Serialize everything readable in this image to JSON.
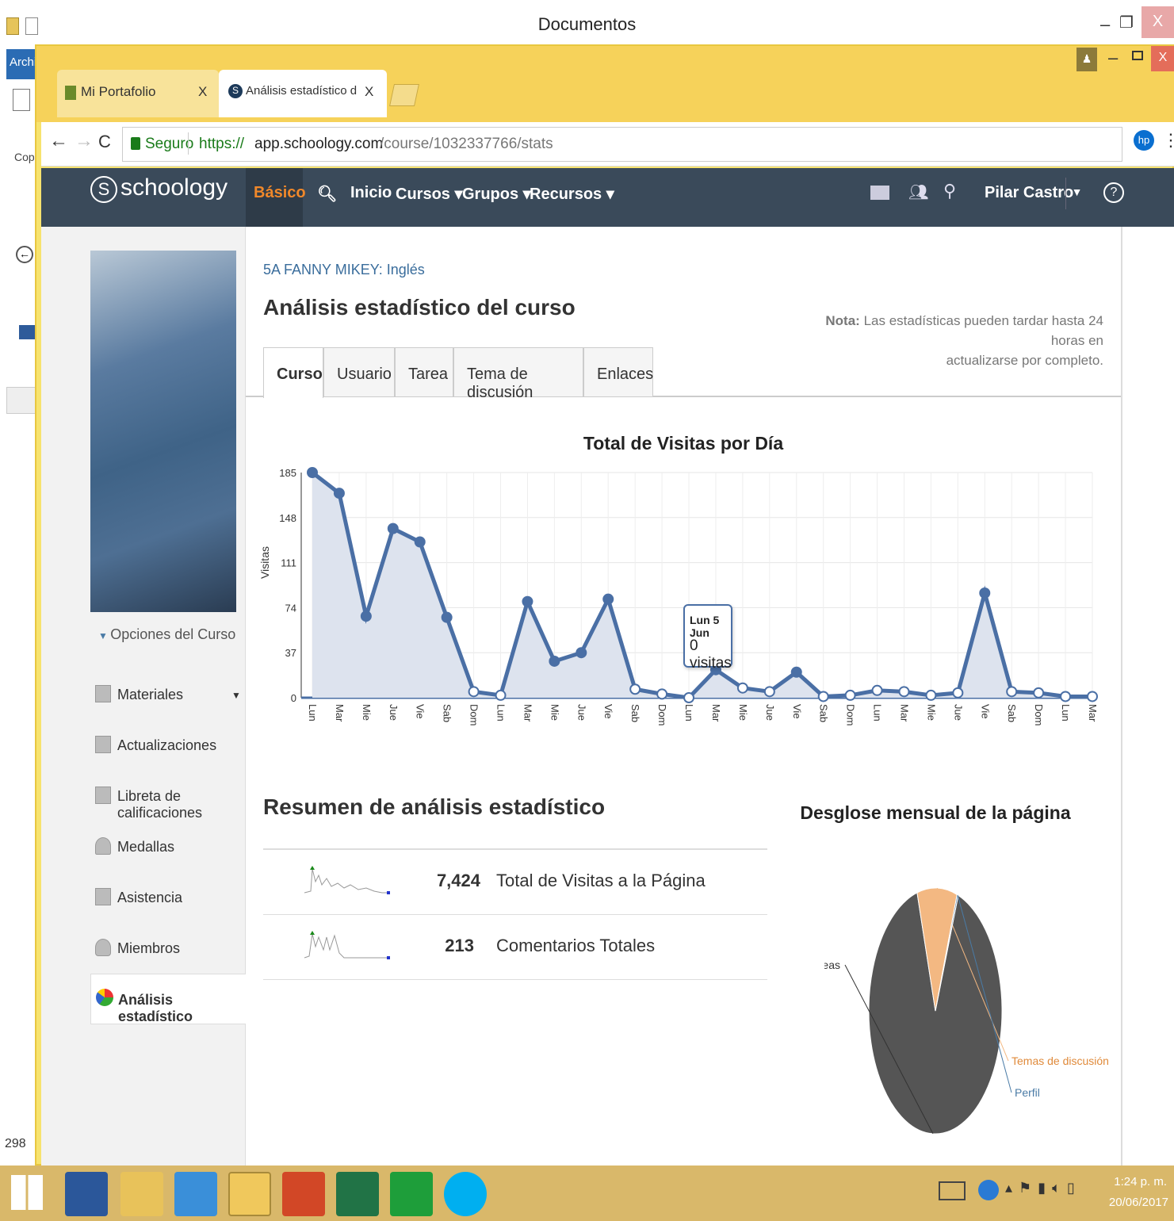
{
  "explorer": {
    "title": "Documentos",
    "tab": "Archi",
    "copy_label": "Copi",
    "count": "298"
  },
  "browser": {
    "tabs": [
      {
        "label": "Mi Portafolio",
        "close": "X"
      },
      {
        "label": "Análisis estadístico del cu",
        "close": "X"
      }
    ],
    "secure": "Seguro",
    "url_scheme": "https://",
    "url_host": "app.schoology.com",
    "url_path": "/course/1032337766/stats"
  },
  "nav": {
    "logo": "schoology",
    "basico": "Básico",
    "inicio": "Inicio",
    "cursos": "Cursos ▾",
    "grupos": "Grupos ▾",
    "recursos": "Recursos ▾",
    "user": "Pilar Castro",
    "help": "?"
  },
  "sidebar": {
    "options": "Opciones del Curso",
    "items": [
      "Materiales",
      "Actualizaciones",
      "Libreta de calificaciones",
      "Medallas",
      "Asistencia",
      "Miembros",
      "Análisis estadístico"
    ]
  },
  "page": {
    "breadcrumb": "5A FANNY MIKEY: Inglés",
    "title": "Análisis estadístico del curso",
    "note_bold": "Nota:",
    "note_line1": "Las estadísticas pueden tardar hasta 24 horas en",
    "note_line2": "actualizarse por completo.",
    "tabs": [
      "Curso",
      "Usuario",
      "Tarea",
      "Tema de discusión",
      "Enlaces"
    ]
  },
  "chart_data": [
    {
      "type": "line",
      "title": "Total de Visitas por Día",
      "ylabel": "Visitas",
      "ylim": [
        0,
        185
      ],
      "yticks": [
        0,
        37,
        74,
        111,
        148,
        185
      ],
      "categories": [
        "Lun",
        "Mar",
        "Mie",
        "Jue",
        "Vie",
        "Sab",
        "Dom",
        "Lun",
        "Mar",
        "Mie",
        "Jue",
        "Vie",
        "Sab",
        "Dom",
        "Lun",
        "Mar",
        "Mie",
        "Jue",
        "Vie",
        "Sab",
        "Dom",
        "Lun",
        "Mar",
        "Mie",
        "Jue",
        "Vie",
        "Sab",
        "Dom",
        "Lun",
        "Mar"
      ],
      "values": [
        185,
        168,
        67,
        139,
        128,
        66,
        5,
        2,
        79,
        30,
        37,
        81,
        7,
        3,
        0,
        23,
        8,
        5,
        21,
        1,
        2,
        6,
        5,
        2,
        4,
        86,
        5,
        4,
        1,
        1
      ],
      "tooltip": {
        "title": "Lun 5 Jun",
        "value": "0 visitas"
      }
    },
    {
      "type": "pie",
      "title": "Desglose mensual de la página",
      "categories": [
        "Tareas",
        "Temas de discusión",
        "Perfil"
      ],
      "values": [
        90,
        9.7,
        0.3
      ],
      "colors": [
        "#555555",
        "#f3b882",
        "#4a7ba6"
      ]
    }
  ],
  "summary": {
    "title": "Resumen de análisis estadístico",
    "rows": [
      {
        "value": "7,424",
        "label": "Total de Visitas a la Página"
      },
      {
        "value": "213",
        "label": "Comentarios Totales"
      }
    ]
  },
  "taskbar": {
    "time": "1:24 p. m.",
    "date": "20/06/2017"
  }
}
